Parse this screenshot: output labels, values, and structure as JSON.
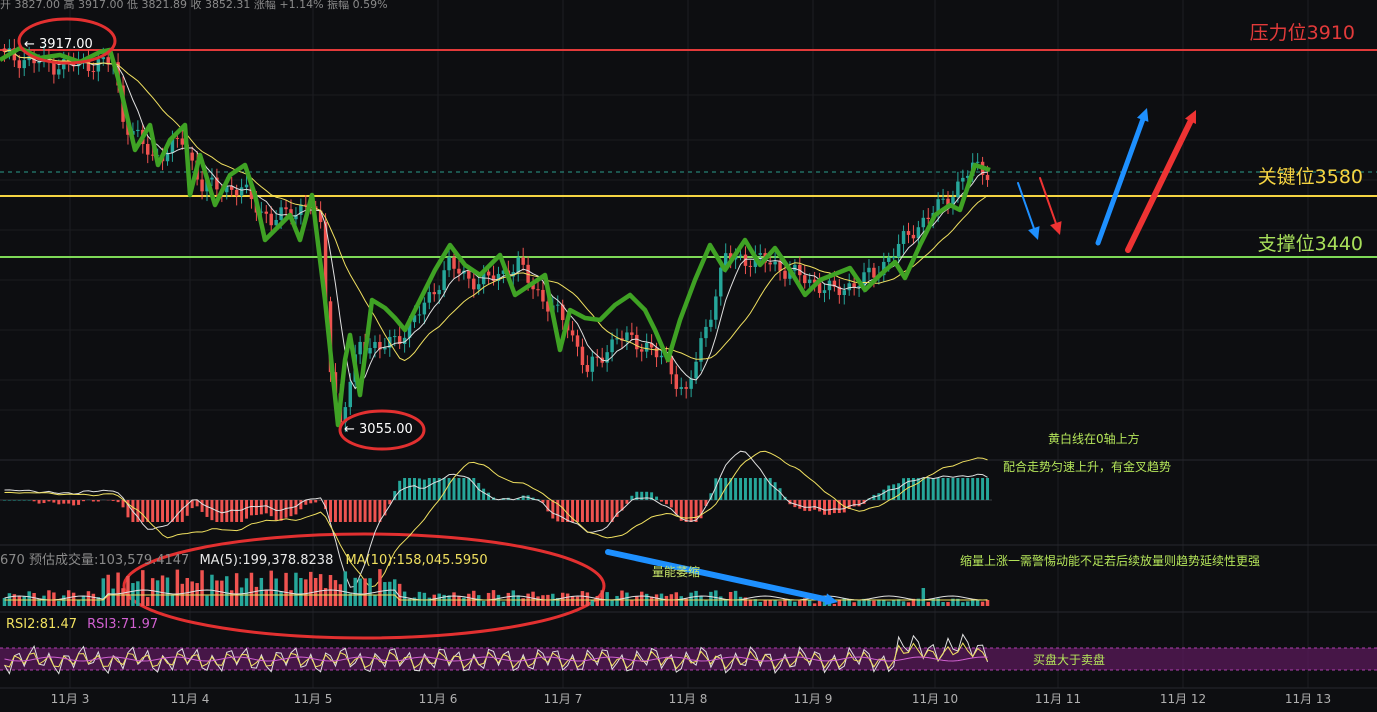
{
  "top_strip": "开 3827.00  高 3917.00  低 3821.89  收 3852.31  涨幅 +1.14%  振幅 0.59%",
  "levels": {
    "resistance": {
      "label": "压力位3910",
      "value": 3910,
      "color": "#e23a3a"
    },
    "key": {
      "label": "关键位3580",
      "value": 3580,
      "color": "#f5d442"
    },
    "support": {
      "label": "支撑位3440",
      "value": 3440,
      "color": "#7ed957"
    }
  },
  "markers": {
    "high": "← 3917.00",
    "low": "← 3055.00"
  },
  "annotations": {
    "macd_note_1": "黄白线在0轴上方",
    "macd_note_2": "配合走势匀速上升，有金叉趋势",
    "volume_note": "缩量上涨一需警惕动能不足若后续放量则趋势延续性更强",
    "volume_arrow_label": "量能萎缩",
    "rsi_note": "买盘大于卖盘"
  },
  "volume_stats": {
    "prefix": "670",
    "estimate": "预估成交量:103,579.4147",
    "ma5": "MA(5):199,378.8238",
    "ma10": "MA(10):158,045.5950"
  },
  "rsi_stats": {
    "rsi2": "RSI2:81.47",
    "rsi3": "RSI3:71.97"
  },
  "colors": {
    "up": "#26a69a",
    "down": "#ef5350",
    "trend": "#3fa224",
    "ma_fast": "#e0e0e0",
    "ma_slow": "#f0e060",
    "rsi_band": "#5a1a5a",
    "blue_arrow": "#1e90ff",
    "red_arrow": "#ee3333"
  },
  "chart_data": {
    "type": "line",
    "x_ticks": [
      "11月 3",
      "11月 4",
      "11月 5",
      "11月 6",
      "11月 7",
      "11月 8",
      "11月 9",
      "11月 10",
      "11月 11",
      "11月 12",
      "11月 13"
    ],
    "price_range": [
      3000,
      3950
    ],
    "trend_path": [
      [
        "11月 3",
        3870
      ],
      [
        "11月 3",
        3905
      ],
      [
        "11月 3",
        3840
      ],
      [
        "11月 4",
        3730
      ],
      [
        "11月 4",
        3680
      ],
      [
        "11月 4",
        3740
      ],
      [
        "11月 4",
        3610
      ],
      [
        "11月 4",
        3660
      ],
      [
        "11月 4",
        3560
      ],
      [
        "11月 4",
        3640
      ],
      [
        "11月 5",
        3500
      ],
      [
        "11月 5",
        3560
      ],
      [
        "11月 5",
        3560
      ],
      [
        "11月 5",
        3360
      ],
      [
        "11月 5",
        3055
      ],
      [
        "11月 5",
        3230
      ],
      [
        "11月 5",
        3080
      ],
      [
        "11月 5",
        3280
      ],
      [
        "11月 6",
        3220
      ],
      [
        "11月 6",
        3420
      ],
      [
        "11month 6",
        3400
      ]
    ],
    "series": [
      {
        "name": "MA(5)",
        "values_note": "price moving average (fast)"
      },
      {
        "name": "MA(10)",
        "values_note": "price moving average (slow)"
      }
    ]
  }
}
